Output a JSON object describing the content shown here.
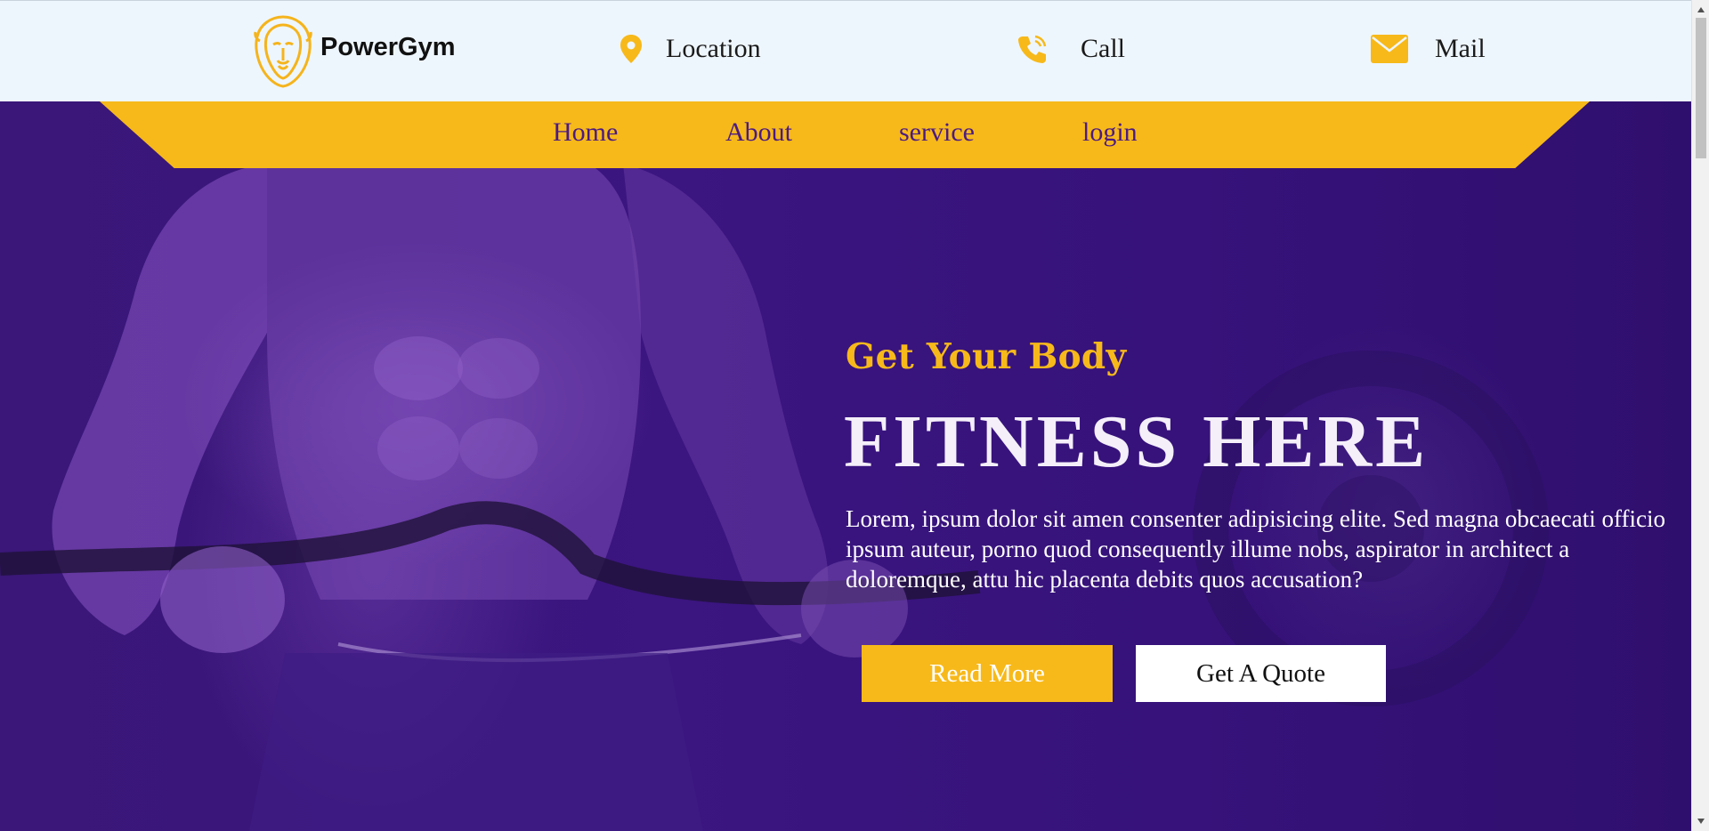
{
  "brand": {
    "name": "PowerGym",
    "logo_icon": "lion-head-icon"
  },
  "contact": {
    "location": {
      "label": "Location",
      "icon": "map-pin-icon"
    },
    "call": {
      "label": "Call",
      "icon": "phone-icon"
    },
    "mail": {
      "label": "Mail",
      "icon": "envelope-icon"
    }
  },
  "nav": {
    "items": [
      "Home",
      "About",
      "service",
      "login"
    ]
  },
  "hero": {
    "subtitle": "Get Your Body",
    "title": "FITNESS HERE",
    "text": "Lorem, ipsum dolor sit amen consenter adipisicing elite. Sed magna obcaecati officio ipsum auteur, porno quod consequently illume nobs, aspirator in architect a doloremque, attu hic placenta debits quos accusation?",
    "read_more": "Read More",
    "get_quote": "Get A Quote"
  },
  "colors": {
    "accent": "#f7b91a",
    "hero_bg": "#3a1778",
    "topbar_bg": "#eef6fd",
    "nav_text": "#4b1b84"
  }
}
